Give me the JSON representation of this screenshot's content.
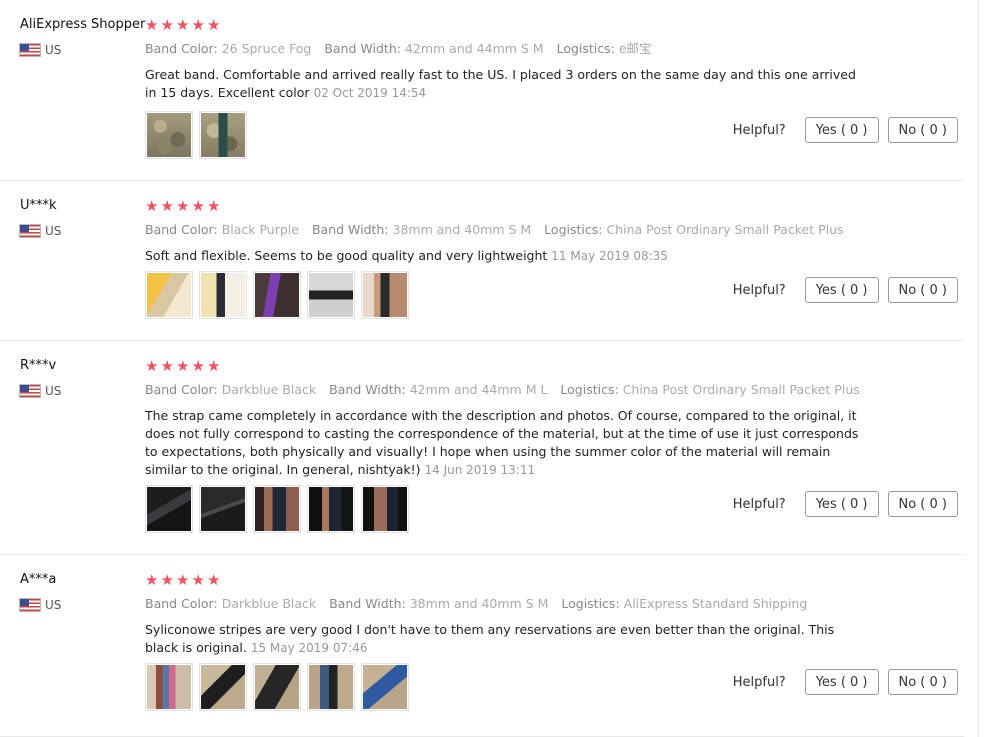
{
  "labels": {
    "band_color": "Band Color:",
    "band_width": "Band Width:",
    "logistics": "Logistics:",
    "helpful": "Helpful?",
    "yes": "Yes ( 0 )",
    "no": "No ( 0 )"
  },
  "colors": {
    "star": "#f0525f"
  },
  "reviews": [
    {
      "user": "AliExpress Shopper",
      "country": "US",
      "stars": 5,
      "band_color": "26 Spruce Fog",
      "band_width": "42mm and 44mm S M",
      "logistics": "e邮宝",
      "text": "Great band. Comfortable and arrived really fast to the US. I placed 3 orders on the same day and this one arrived in 15 days. Excellent color",
      "date": "02 Oct 2019 14:54",
      "photos": [
        "camo-band-photo-1",
        "camo-band-photo-2"
      ]
    },
    {
      "user": "U***k",
      "country": "US",
      "stars": 5,
      "band_color": "Black Purple",
      "band_width": "38mm and 40mm S M",
      "logistics": "China Post Ordinary Small Packet Plus",
      "text": "Soft and flexible. Seems to be good quality and very lightweight",
      "date": "11 May 2019 08:35",
      "photos": [
        "band-photo-1",
        "band-photo-2",
        "band-photo-3",
        "band-photo-4",
        "band-photo-5"
      ]
    },
    {
      "user": "R***v",
      "country": "US",
      "stars": 5,
      "band_color": "Darkblue Black",
      "band_width": "42mm and 44mm M L",
      "logistics": "China Post Ordinary Small Packet Plus",
      "text": "The strap came completely in accordance with the description and photos. Of course, compared to the original, it does not fully correspond to casting the correspondence of the material, but at the time of use it just corresponds to expectations, both physically and visually! I hope when using the summer color of the material will remain similar to the original. In general, nishtyak!)",
      "date": "14 Jun 2019 13:11",
      "photos": [
        "dark-band-photo-1",
        "dark-band-photo-2",
        "dark-band-photo-3",
        "dark-band-photo-4",
        "dark-band-photo-5"
      ]
    },
    {
      "user": "A***a",
      "country": "US",
      "stars": 5,
      "band_color": "Darkblue Black",
      "band_width": "38mm and 40mm S M",
      "logistics": "AliExpress Standard Shipping",
      "text": "Syliconowe stripes are very good I don't have to them any reservations are even better than the original. This black is original.",
      "date": "15 May 2019 07:46",
      "photos": [
        "strap-photo-1",
        "strap-photo-2",
        "strap-photo-3",
        "strap-photo-4",
        "strap-photo-5"
      ]
    }
  ]
}
